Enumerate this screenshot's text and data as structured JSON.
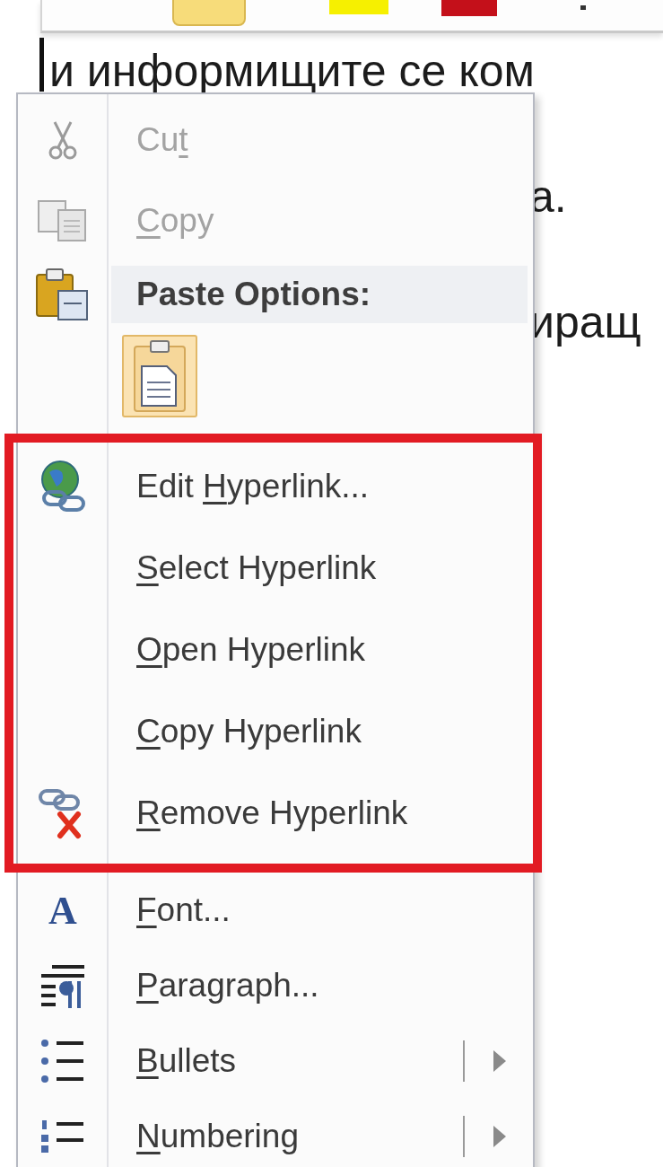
{
  "document": {
    "lines": [
      {
        "kind": "full",
        "text": "и информищите се ком"
      },
      {
        "kind": "right_of_menu",
        "text": "а."
      },
      {
        "kind": "right_of_menu",
        "text": "иращ"
      }
    ]
  },
  "context_menu": {
    "sections": [
      {
        "highlighted": false,
        "items": [
          {
            "kind": "command",
            "label_before": "Cu",
            "access_key": "t",
            "disabled": true,
            "has_submenu": false
          },
          {
            "kind": "command",
            "access_key": "C",
            "label_after": "opy",
            "disabled": true,
            "has_submenu": false
          },
          {
            "kind": "header",
            "label": "Paste Options:"
          },
          {
            "kind": "paste_buttons"
          }
        ]
      },
      {
        "highlighted": true,
        "items": [
          {
            "kind": "command",
            "label_before": "Edit ",
            "access_key": "H",
            "label_after": "yperlink...",
            "disabled": false,
            "has_submenu": false
          },
          {
            "kind": "command",
            "access_key": "S",
            "label_after": "elect Hyperlink",
            "disabled": false,
            "has_submenu": false
          },
          {
            "kind": "command",
            "access_key": "O",
            "label_after": "pen Hyperlink",
            "disabled": false,
            "has_submenu": false
          },
          {
            "kind": "command",
            "access_key": "C",
            "label_after": "opy Hyperlink",
            "disabled": false,
            "has_submenu": false
          },
          {
            "kind": "command",
            "access_key": "R",
            "label_after": "emove Hyperlink",
            "disabled": false,
            "has_submenu": false
          }
        ]
      },
      {
        "highlighted": false,
        "items": [
          {
            "kind": "command",
            "icon_glyph": "A",
            "access_key": "F",
            "label_after": "ont...",
            "disabled": false,
            "has_submenu": false
          },
          {
            "kind": "command",
            "access_key": "P",
            "label_after": "aragraph...",
            "disabled": false,
            "has_submenu": false
          },
          {
            "kind": "command",
            "access_key": "B",
            "label_after": "ullets",
            "disabled": false,
            "has_submenu": true
          },
          {
            "kind": "command",
            "access_key": "N",
            "label_after": "umbering",
            "disabled": false,
            "has_submenu": true
          }
        ]
      }
    ]
  }
}
